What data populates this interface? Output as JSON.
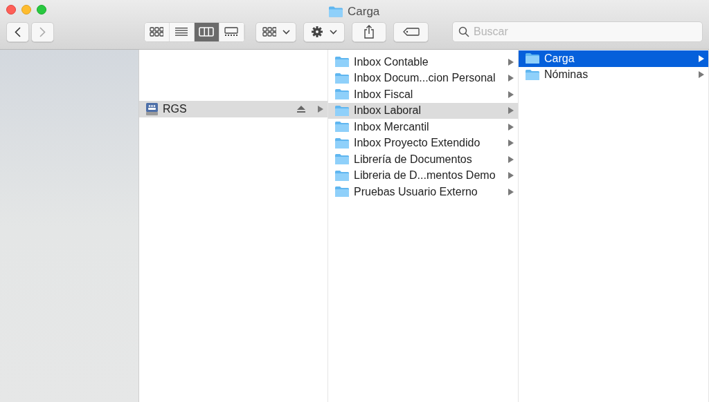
{
  "window": {
    "title": "Carga"
  },
  "toolbar": {
    "view_modes": [
      {
        "kind": "icons",
        "selected": false
      },
      {
        "kind": "list",
        "selected": false
      },
      {
        "kind": "columns",
        "selected": true
      },
      {
        "kind": "gallery",
        "selected": false
      }
    ]
  },
  "search": {
    "placeholder": "Buscar"
  },
  "columns": [
    {
      "focused": false,
      "rows": [
        {
          "kind": "server",
          "name": "RGS",
          "selected": true
        }
      ]
    },
    {
      "focused": false,
      "rows": [
        {
          "kind": "folder",
          "name": "Inbox Contable",
          "selected": false
        },
        {
          "kind": "folder",
          "name": "Inbox Docum...cion Personal",
          "selected": false
        },
        {
          "kind": "folder",
          "name": "Inbox Fiscal",
          "selected": false
        },
        {
          "kind": "folder",
          "name": "Inbox Laboral",
          "selected": true
        },
        {
          "kind": "folder",
          "name": "Inbox Mercantil",
          "selected": false
        },
        {
          "kind": "folder",
          "name": "Inbox Proyecto Extendido",
          "selected": false
        },
        {
          "kind": "folder",
          "name": "Librería de Documentos",
          "selected": false
        },
        {
          "kind": "folder",
          "name": "Libreria de D...mentos Demo",
          "selected": false
        },
        {
          "kind": "folder",
          "name": "Pruebas Usuario Externo",
          "selected": false
        }
      ]
    },
    {
      "focused": true,
      "rows": [
        {
          "kind": "folder",
          "name": "Carga",
          "selected": true
        },
        {
          "kind": "folder",
          "name": "Nóminas",
          "selected": false
        }
      ]
    }
  ]
}
